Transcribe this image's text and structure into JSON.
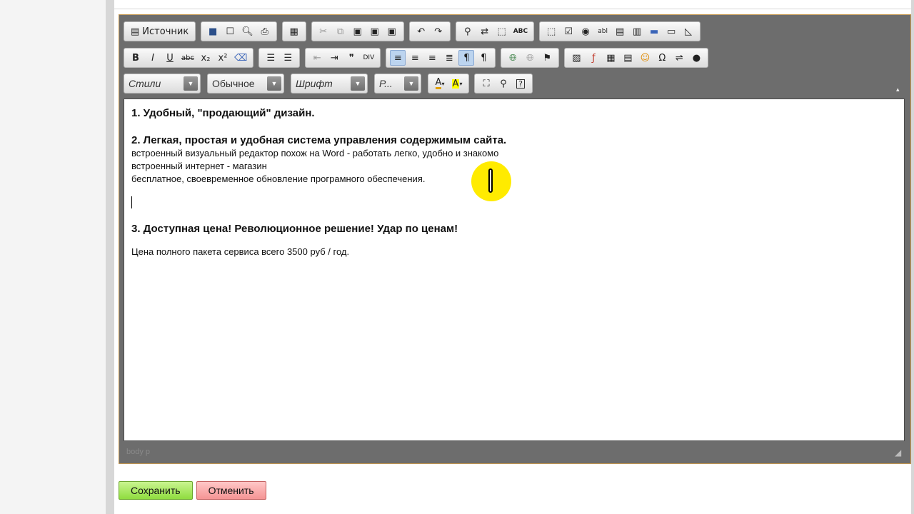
{
  "toolbar": {
    "row1": {
      "source_label": "Источник",
      "group1": [
        "save-icon",
        "new-page-icon",
        "preview-icon",
        "print-icon"
      ],
      "group2": [
        "templates-icon"
      ],
      "group3": [
        "cut-icon",
        "copy-icon",
        "paste-icon",
        "paste-text-icon",
        "paste-word-icon"
      ],
      "group4": [
        "undo-icon",
        "redo-icon"
      ],
      "group5": [
        "find-icon",
        "replace-icon"
      ],
      "group6": [
        "select-all-icon"
      ],
      "group7": [
        "spellcheck-icon"
      ],
      "group8": [
        "form-icon",
        "checkbox-icon",
        "radio-icon",
        "textfield-icon",
        "textarea-icon",
        "select-icon",
        "button-icon",
        "image-button-icon",
        "hidden-field-icon"
      ]
    },
    "row2": {
      "bold": "B",
      "italic": "I",
      "underline": "U",
      "strike": "abc",
      "subscript": "x₂",
      "superscript": "x²",
      "blockquote": "❞"
    },
    "row3": {
      "styles_value": "Стили",
      "format_value": "Обычное",
      "font_value": "Шрифт",
      "size_value": "Р..."
    }
  },
  "content": {
    "heading1": "1. Удобный, \"продающий\" дизайн.",
    "heading2": "2. Легкая, простая и удобная система управления содержимым сайта.",
    "line1": "встроенный визуальный редактор похож на Word - работать легко, удобно и знакомо",
    "line2": "встроенный интернет - магазин",
    "line3": "бесплатное, своевременное обновление програмного обеспечения.",
    "heading3": "3. Доступная цена! Революционное решение! Удар по ценам!",
    "price_line": "Цена полного пакета сервиса всего 3500 руб / год."
  },
  "statusbar": {
    "path": "body  p"
  },
  "actions": {
    "save_label": "Сохранить",
    "cancel_label": "Отменить"
  },
  "colors": {
    "save_green": "#8fdc3f",
    "cancel_red": "#f59494",
    "cursor_highlight": "#ffeb00",
    "editor_frame": "#6d6d6d"
  }
}
